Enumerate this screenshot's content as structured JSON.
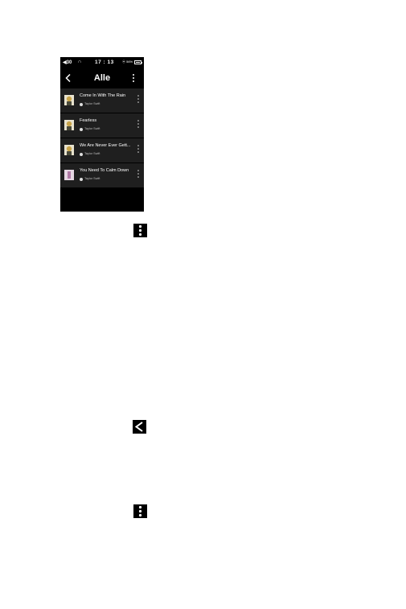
{
  "statusbar": {
    "volume": "◀30",
    "headphone": "∩",
    "time": "17 : 13",
    "battery": "⦿ 56%",
    "battery_level": 0.56
  },
  "topbar": {
    "title": "Alle"
  },
  "songs": [
    {
      "title": "Come In With The Rain",
      "artist": "Taylor Swift"
    },
    {
      "title": "Fearless",
      "artist": "Taylor Swift"
    },
    {
      "title": "We Are Never Ever Gett...",
      "artist": "Taylor Swift"
    },
    {
      "title": "You Need To Calm Down",
      "artist": "Taylor Swift"
    }
  ],
  "icons": {
    "more": "more-vertical-icon",
    "back": "back-chevron-icon",
    "album": "album-art-icon"
  }
}
